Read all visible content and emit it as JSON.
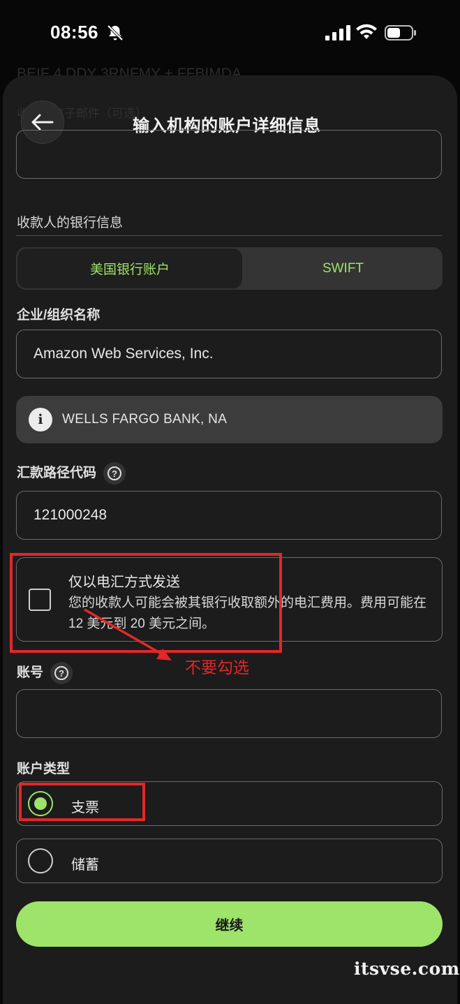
{
  "status_bar": {
    "time": "08:56"
  },
  "background_ghost": {
    "line1": "BEIF 4 DDY 3RNFMY + FFBIMDA",
    "line2": "收款人电子邮件（可选）"
  },
  "header": {
    "title": "输入机构的账户详细信息"
  },
  "form": {
    "section_label": "收款人的银行信息",
    "tabs": [
      {
        "label": "美国银行账户",
        "selected": true
      },
      {
        "label": "SWIFT",
        "selected": false
      }
    ],
    "company_label": "企业/组织名称",
    "company_value": "Amazon Web Services, Inc.",
    "bank_info": "WELLS FARGO BANK, NA",
    "routing_label": "汇款路径代码",
    "routing_value": "121000248",
    "wire_only": {
      "title": "仅以电汇方式发送",
      "description": "您的收款人可能会被其银行收取额外的电汇费用。费用可能在 12 美元到 20 美元之间。",
      "checked": false
    },
    "account_label": "账号",
    "account_value": "",
    "account_type_label": "账户类型",
    "account_types": [
      {
        "label": "支票",
        "selected": true
      },
      {
        "label": "储蓄",
        "selected": false
      }
    ],
    "continue_label": "继续"
  },
  "annotation": {
    "text": "不要勾选",
    "color": "#e3272a"
  },
  "watermark": "itsvse.com",
  "colors": {
    "accent": "#9ee36a",
    "sheet": "#1b1c1b",
    "annotation": "#e3272a"
  }
}
